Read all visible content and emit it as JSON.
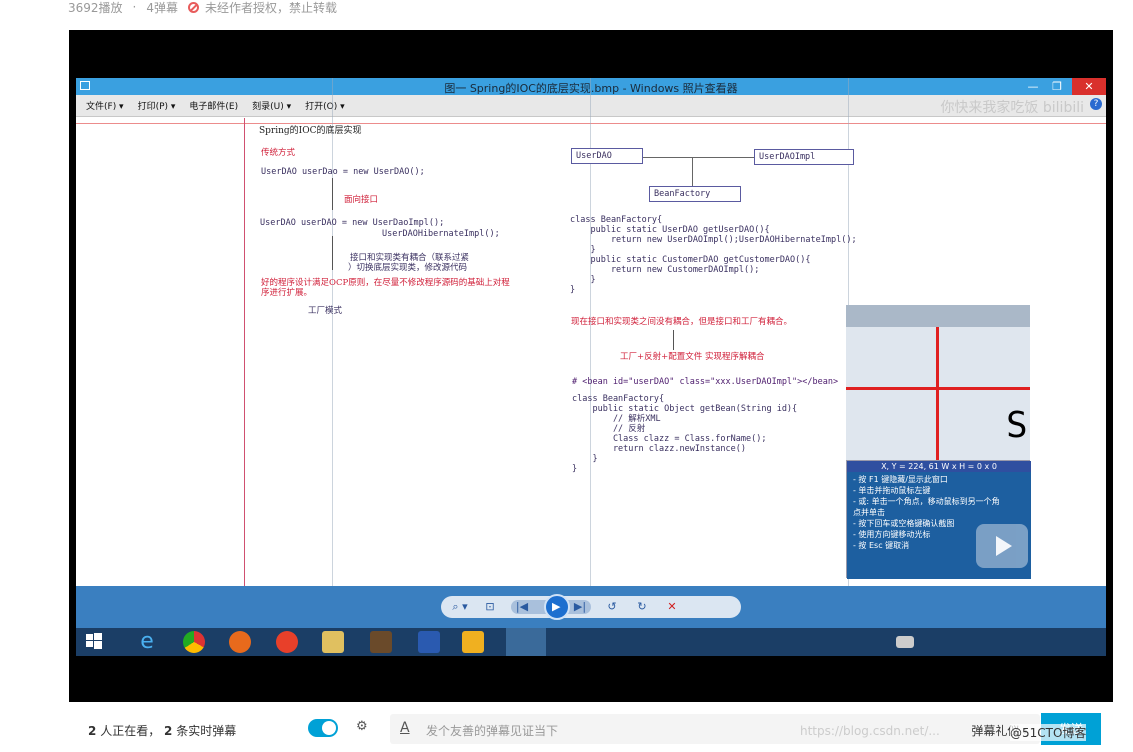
{
  "meta": {
    "plays": "3692播放",
    "sep": "·",
    "danmaku_count": "4弹幕",
    "copyright": "未经作者授权，禁止转载"
  },
  "window": {
    "title": "图一 Spring的IOC的底层实现.bmp - Windows 照片查看器",
    "menu": [
      "文件(F) ▾",
      "打印(P) ▾",
      "电子邮件(E)",
      "刻录(U) ▾",
      "打开(O) ▾"
    ],
    "watermark": "你快来我家吃饭 bilibili",
    "controls": {
      "minimize": "—",
      "restore": "❐",
      "close": "✕"
    }
  },
  "slide": {
    "heading": "Spring的IOC的底层实现",
    "traditional": "传统方式",
    "line1": "UserDAO userDao = new UserDAO();",
    "interface_label": "面向接口",
    "line2a": "UserDAO userDAO = new UserDaoImpl();",
    "line2b": "UserDAOHibernateImpl();",
    "coupling_a": "接口和实现类有耦合（联系过紧",
    "coupling_b": "）切换底层实现类，修改源代码",
    "ocp_a": "好的程序设计满足OCP原则，在尽量不修改程序源码的基础上对程",
    "ocp_b": "序进行扩展。",
    "factory_mode": "工厂模式",
    "box_userdao": "UserDAO",
    "box_userdaoimpl": "UserDAOImpl",
    "box_beanfactory": "BeanFactory",
    "code1": [
      "class BeanFactory{",
      "",
      "    public static UserDAO getUserDAO(){",
      "        return new UserDAOImpl();UserDAOHibernateImpl();",
      "    }",
      "    public static CustomerDAO getCustomerDAO(){",
      "        return new CustomerDAOImpl();",
      "    }",
      "",
      "}"
    ],
    "note_coupling": "现在接口和实现类之间没有耦合，但是接口和工厂有耦合。",
    "note_decouple": "工厂+反射+配置文件   实现程序解耦合",
    "xml_line": "# <bean id=\"userDAO\" class=\"xxx.UserDAOImpl\"></bean>",
    "code2": [
      "class BeanFactory{",
      "",
      "    public static Object getBean(String id){",
      "        // 解析XML",
      "",
      "        // 反射",
      "        Class clazz = Class.forName();",
      "",
      "        return clazz.newInstance()",
      "    }",
      "}"
    ]
  },
  "toolbar": {
    "zoom": "⌕ ▾",
    "fit": "⊡",
    "prev": "|◀",
    "play": "▶",
    "next": "▶|",
    "rotl": "↺",
    "rotr": "↻",
    "delete": "✕"
  },
  "magnifier": {
    "readout": "X, Y = 224, 61     W x H = 0 x 0",
    "tips": [
      "- 按 F1 键隐藏/显示此窗口",
      "- 单击并拖动鼠标左键",
      "- 或: 单击一个角点，移动鼠标到另一个角",
      "  点并单击",
      "- 按下回车或空格键确认截图",
      "- 使用方向键移动光标",
      "- 按 Esc 键取消"
    ]
  },
  "footer": {
    "viewers_count": "2",
    "viewers_text": "人正在看，",
    "live_count": "2",
    "live_text": "条实时弹幕",
    "input_placeholder": "发个友善的弹幕见证当下",
    "etiquette": "弹幕礼仪 ›",
    "send": "发送",
    "watermark": "https://blog.csdn.net/...",
    "blog": "@51CTO博客"
  },
  "colors": {
    "accent": "#00a1d6",
    "titlebar": "#3aa0e0",
    "close": "#d9302c",
    "taskbar": "#1b3e66"
  }
}
